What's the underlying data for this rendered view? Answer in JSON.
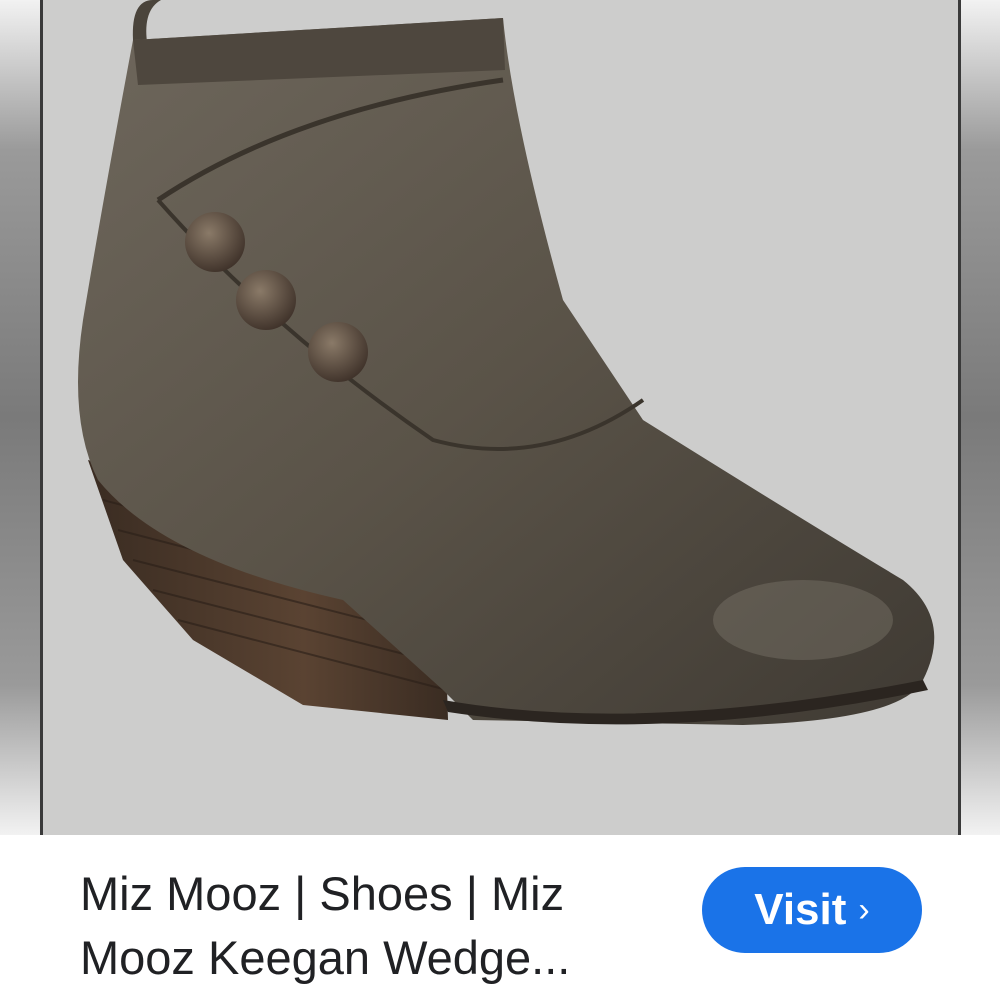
{
  "result": {
    "image_alt": "Miz Mooz Keegan wedge ankle boot",
    "title_line1": "Miz Mooz | Shoes | Miz",
    "title_line2": "Mooz Keegan Wedge..."
  },
  "visit_button": {
    "label": "Visit",
    "chevron": "›",
    "color": "#1a73e8"
  },
  "icons": {
    "visit_chevron": "chevron-right-icon"
  }
}
